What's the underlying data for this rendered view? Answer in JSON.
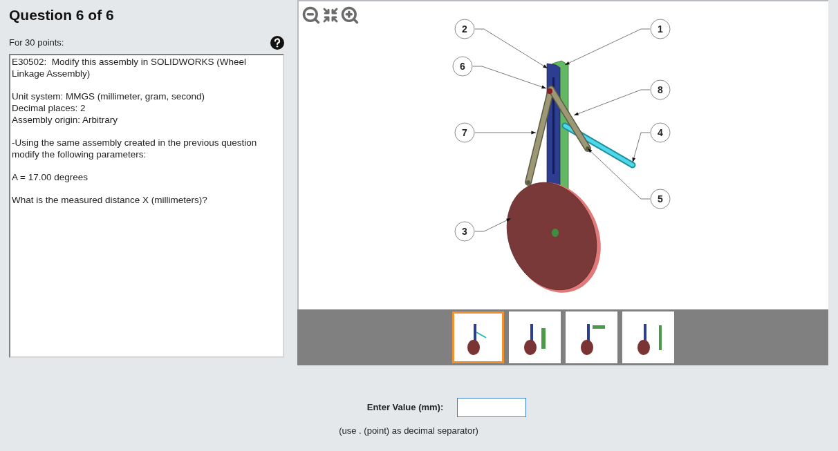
{
  "title": "Question 6 of 6",
  "points": "For 30 points:",
  "question_text": [
    {
      "lines": [
        "E30502:  Modify this assembly in SOLIDWORKS (Wheel Linkage Assembly)"
      ]
    },
    {
      "lines": [
        "Unit system: MMGS (millimeter, gram, second)",
        "Decimal places: 2",
        "Assembly origin: Arbitrary"
      ]
    },
    {
      "lines": [
        "-Using the same assembly created in the previous question modify the following parameters:"
      ]
    },
    {
      "lines": [
        "A = 17.00 degrees"
      ]
    },
    {
      "lines": [
        "What is the measured distance X (millimeters)?"
      ]
    }
  ],
  "callouts": [
    {
      "label": "2"
    },
    {
      "label": "1"
    },
    {
      "label": "6"
    },
    {
      "label": "8"
    },
    {
      "label": "7"
    },
    {
      "label": "4"
    },
    {
      "label": "5"
    },
    {
      "label": "3"
    }
  ],
  "thumbnails": [
    {
      "selected": true
    },
    {
      "selected": false
    },
    {
      "selected": false
    },
    {
      "selected": false
    }
  ],
  "answer": {
    "label": "Enter Value (mm):",
    "hint": "(use . (point) as decimal separator)"
  }
}
